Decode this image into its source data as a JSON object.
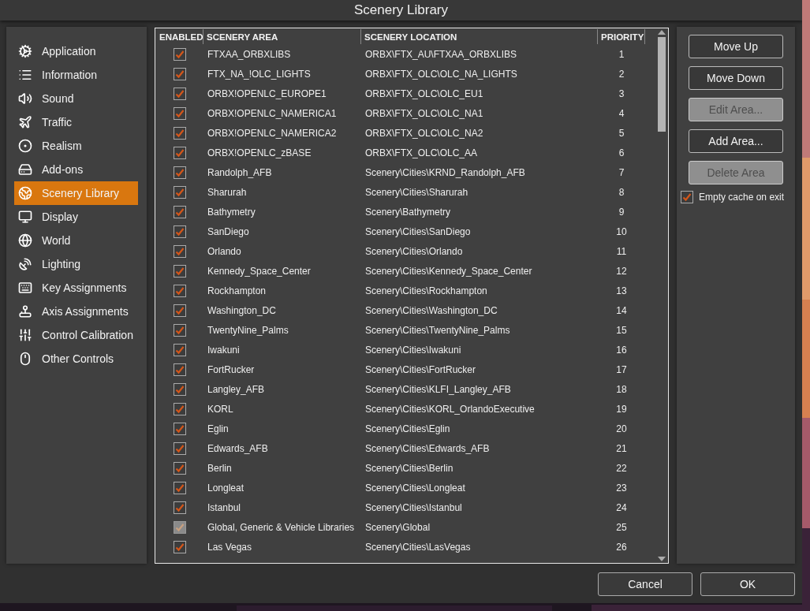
{
  "window": {
    "title": "Scenery Library"
  },
  "sidebar": {
    "items": [
      {
        "label": "Application",
        "selected": false
      },
      {
        "label": "Information",
        "selected": false
      },
      {
        "label": "Sound",
        "selected": false
      },
      {
        "label": "Traffic",
        "selected": false
      },
      {
        "label": "Realism",
        "selected": false
      },
      {
        "label": "Add-ons",
        "selected": false
      },
      {
        "label": "Scenery Library",
        "selected": true
      },
      {
        "label": "Display",
        "selected": false
      },
      {
        "label": "World",
        "selected": false
      },
      {
        "label": "Lighting",
        "selected": false
      },
      {
        "label": "Key Assignments",
        "selected": false
      },
      {
        "label": "Axis Assignments",
        "selected": false
      },
      {
        "label": "Control Calibration",
        "selected": false
      },
      {
        "label": "Other Controls",
        "selected": false
      }
    ]
  },
  "table": {
    "columns": [
      "ENABLED",
      "SCENERY AREA",
      "SCENERY LOCATION",
      "PRIORITY"
    ],
    "rows": [
      {
        "enabled": true,
        "disabled": false,
        "area": "FTXAA_ORBXLIBS",
        "location": "ORBX\\FTX_AU\\FTXAA_ORBXLIBS",
        "priority": "1"
      },
      {
        "enabled": true,
        "disabled": false,
        "area": "FTX_NA_!OLC_LIGHTS",
        "location": "ORBX\\FTX_OLC\\OLC_NA_LIGHTS",
        "priority": "2"
      },
      {
        "enabled": true,
        "disabled": false,
        "area": "ORBX!OPENLC_EUROPE1",
        "location": "ORBX\\FTX_OLC\\OLC_EU1",
        "priority": "3"
      },
      {
        "enabled": true,
        "disabled": false,
        "area": "ORBX!OPENLC_NAMERICA1",
        "location": "ORBX\\FTX_OLC\\OLC_NA1",
        "priority": "4"
      },
      {
        "enabled": true,
        "disabled": false,
        "area": "ORBX!OPENLC_NAMERICA2",
        "location": "ORBX\\FTX_OLC\\OLC_NA2",
        "priority": "5"
      },
      {
        "enabled": true,
        "disabled": false,
        "area": "ORBX!OPENLC_zBASE",
        "location": "ORBX\\FTX_OLC\\OLC_AA",
        "priority": "6"
      },
      {
        "enabled": true,
        "disabled": false,
        "area": "Randolph_AFB",
        "location": "Scenery\\Cities\\KRND_Randolph_AFB",
        "priority": "7"
      },
      {
        "enabled": true,
        "disabled": false,
        "area": "Sharurah",
        "location": "Scenery\\Cities\\Sharurah",
        "priority": "8"
      },
      {
        "enabled": true,
        "disabled": false,
        "area": "Bathymetry",
        "location": "Scenery\\Bathymetry",
        "priority": "9"
      },
      {
        "enabled": true,
        "disabled": false,
        "area": "SanDiego",
        "location": "Scenery\\Cities\\SanDiego",
        "priority": "10"
      },
      {
        "enabled": true,
        "disabled": false,
        "area": "Orlando",
        "location": "Scenery\\Cities\\Orlando",
        "priority": "11"
      },
      {
        "enabled": true,
        "disabled": false,
        "area": "Kennedy_Space_Center",
        "location": "Scenery\\Cities\\Kennedy_Space_Center",
        "priority": "12"
      },
      {
        "enabled": true,
        "disabled": false,
        "area": "Rockhampton",
        "location": "Scenery\\Cities\\Rockhampton",
        "priority": "13"
      },
      {
        "enabled": true,
        "disabled": false,
        "area": "Washington_DC",
        "location": "Scenery\\Cities\\Washington_DC",
        "priority": "14"
      },
      {
        "enabled": true,
        "disabled": false,
        "area": "TwentyNine_Palms",
        "location": "Scenery\\Cities\\TwentyNine_Palms",
        "priority": "15"
      },
      {
        "enabled": true,
        "disabled": false,
        "area": "Iwakuni",
        "location": "Scenery\\Cities\\Iwakuni",
        "priority": "16"
      },
      {
        "enabled": true,
        "disabled": false,
        "area": "FortRucker",
        "location": "Scenery\\Cities\\FortRucker",
        "priority": "17"
      },
      {
        "enabled": true,
        "disabled": false,
        "area": "Langley_AFB",
        "location": "Scenery\\Cities\\KLFI_Langley_AFB",
        "priority": "18"
      },
      {
        "enabled": true,
        "disabled": false,
        "area": "KORL",
        "location": "Scenery\\Cities\\KORL_OrlandoExecutive",
        "priority": "19"
      },
      {
        "enabled": true,
        "disabled": false,
        "area": "Eglin",
        "location": "Scenery\\Cities\\Eglin",
        "priority": "20"
      },
      {
        "enabled": true,
        "disabled": false,
        "area": "Edwards_AFB",
        "location": "Scenery\\Cities\\Edwards_AFB",
        "priority": "21"
      },
      {
        "enabled": true,
        "disabled": false,
        "area": "Berlin",
        "location": "Scenery\\Cities\\Berlin",
        "priority": "22"
      },
      {
        "enabled": true,
        "disabled": false,
        "area": "Longleat",
        "location": "Scenery\\Cities\\Longleat",
        "priority": "23"
      },
      {
        "enabled": true,
        "disabled": false,
        "area": "Istanbul",
        "location": "Scenery\\Cities\\Istanbul",
        "priority": "24"
      },
      {
        "enabled": true,
        "disabled": true,
        "area": "Global, Generic & Vehicle Libraries",
        "location": "Scenery\\Global",
        "priority": "25"
      },
      {
        "enabled": true,
        "disabled": false,
        "area": "Las Vegas",
        "location": "Scenery\\Cities\\LasVegas",
        "priority": "26"
      }
    ]
  },
  "actions": [
    {
      "label": "Move Up",
      "disabled": false
    },
    {
      "label": "Move Down",
      "disabled": false
    },
    {
      "label": "Edit Area...",
      "disabled": true
    },
    {
      "label": "Add Area...",
      "disabled": false
    },
    {
      "label": "Delete Area",
      "disabled": true
    }
  ],
  "empty_cache": {
    "label": "Empty cache on exit",
    "checked": true
  },
  "dialog_buttons": [
    "Cancel",
    "OK"
  ]
}
